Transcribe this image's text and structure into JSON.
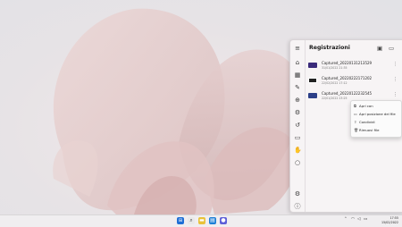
{
  "panel": {
    "title": "Registrazioni",
    "recordings": [
      {
        "name": "Captured_20220131213529",
        "date": "31/01/2022 21:35",
        "thumb_color": "#3a2a7a"
      },
      {
        "name": "Captured_20220222171202",
        "date": "22/02/2022 17:12",
        "thumb_color": "#222222"
      },
      {
        "name": "Captured_20220122232545",
        "date": "22/01/2022 23:25",
        "thumb_color": "#2c3f88"
      }
    ]
  },
  "context_menu": {
    "items": [
      {
        "label": "Apri con",
        "icon": "open-with-icon"
      },
      {
        "label": "Apri posizione del file",
        "icon": "folder-icon"
      },
      {
        "label": "Condividi",
        "icon": "share-icon"
      },
      {
        "label": "Rimuovi file",
        "icon": "trash-icon"
      }
    ]
  },
  "taskbar": {
    "time": "17:55",
    "date": "15/02/2022"
  }
}
